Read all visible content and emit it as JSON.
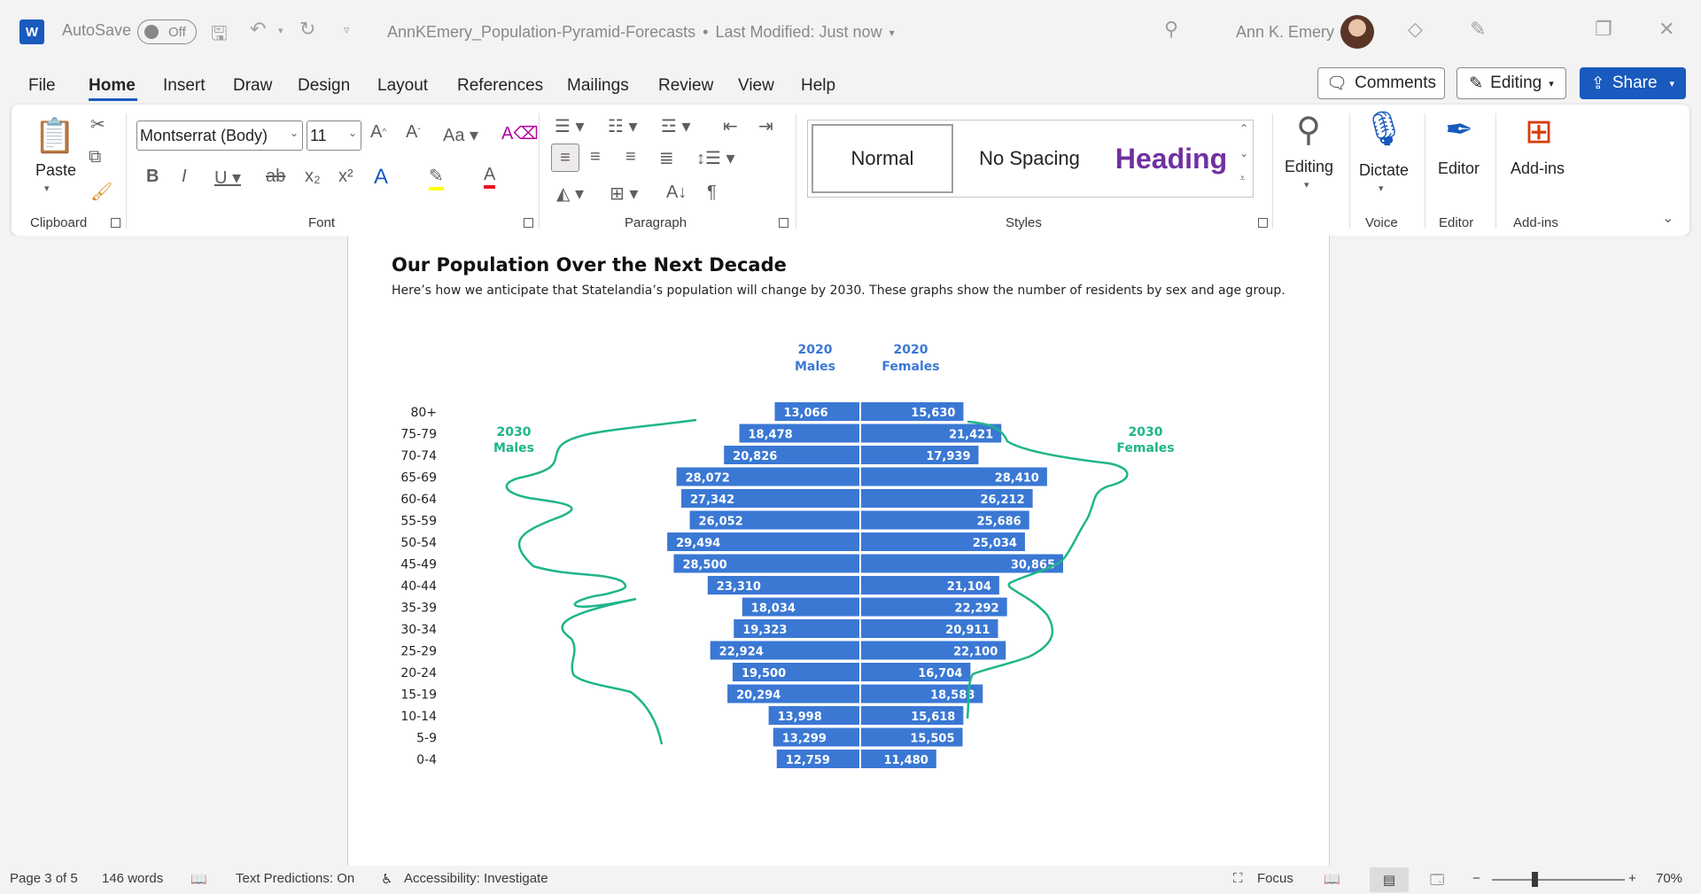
{
  "titlebar": {
    "app_icon": "W",
    "autosave_label": "AutoSave",
    "autosave_state": "Off",
    "doc_title": "AnnKEmery_Population-Pyramid-Forecasts",
    "modified": "Last Modified: Just now",
    "user_name": "Ann K. Emery"
  },
  "menu": {
    "tabs": [
      "File",
      "Home",
      "Insert",
      "Draw",
      "Design",
      "Layout",
      "References",
      "Mailings",
      "Review",
      "View",
      "Help"
    ],
    "comments_label": "Comments",
    "editing_label": "Editing",
    "share_label": "Share"
  },
  "ribbon": {
    "clipboard": {
      "paste_label": "Paste",
      "group_label": "Clipboard"
    },
    "font": {
      "font_name": "Montserrat (Body)",
      "font_size": "11",
      "group_label": "Font"
    },
    "paragraph": {
      "group_label": "Paragraph"
    },
    "styles": {
      "normal": "Normal",
      "no_spacing": "No Spacing",
      "heading": "Heading",
      "group_label": "Styles"
    },
    "editing": {
      "label": "Editing"
    },
    "voice": {
      "dictate_label": "Dictate",
      "group_label": "Voice"
    },
    "editor": {
      "label": "Editor",
      "group_label": "Editor"
    },
    "addins": {
      "label": "Add-ins",
      "group_label": "Add-ins"
    }
  },
  "document": {
    "title": "Our Population Over the Next Decade",
    "subtitle": "Here’s how we anticipate that Statelandia’s population will change by 2030. These graphs show the number of residents by sex and age group."
  },
  "chart_data": {
    "type": "bar",
    "orientation": "horizontal-pyramid",
    "categories": [
      "80+",
      "75-79",
      "70-74",
      "65-69",
      "60-64",
      "55-59",
      "50-54",
      "45-49",
      "40-44",
      "35-39",
      "30-34",
      "25-29",
      "20-24",
      "15-19",
      "10-14",
      "5-9",
      "0-4"
    ],
    "series": [
      {
        "name": "2020 Males",
        "values": [
          13066,
          18478,
          20826,
          28072,
          27342,
          26052,
          29494,
          28500,
          23310,
          18034,
          19323,
          22924,
          19500,
          20294,
          13998,
          13299,
          12759
        ]
      },
      {
        "name": "2020 Females",
        "values": [
          15630,
          21421,
          17939,
          28410,
          26212,
          25686,
          25034,
          30865,
          21104,
          22292,
          20911,
          22100,
          16704,
          18588,
          15618,
          15505,
          11480
        ]
      }
    ],
    "annotations": [
      "2030 Males",
      "2030 Females"
    ],
    "colors": {
      "bars": "#3a78d4",
      "annotation_lines": "#1fb58a",
      "header": "#3a78d4"
    }
  },
  "statusbar": {
    "page": "Page 3 of 5",
    "words": "146 words",
    "text_predictions": "Text Predictions: On",
    "accessibility": "Accessibility: Investigate",
    "focus": "Focus",
    "zoom": "70%"
  }
}
